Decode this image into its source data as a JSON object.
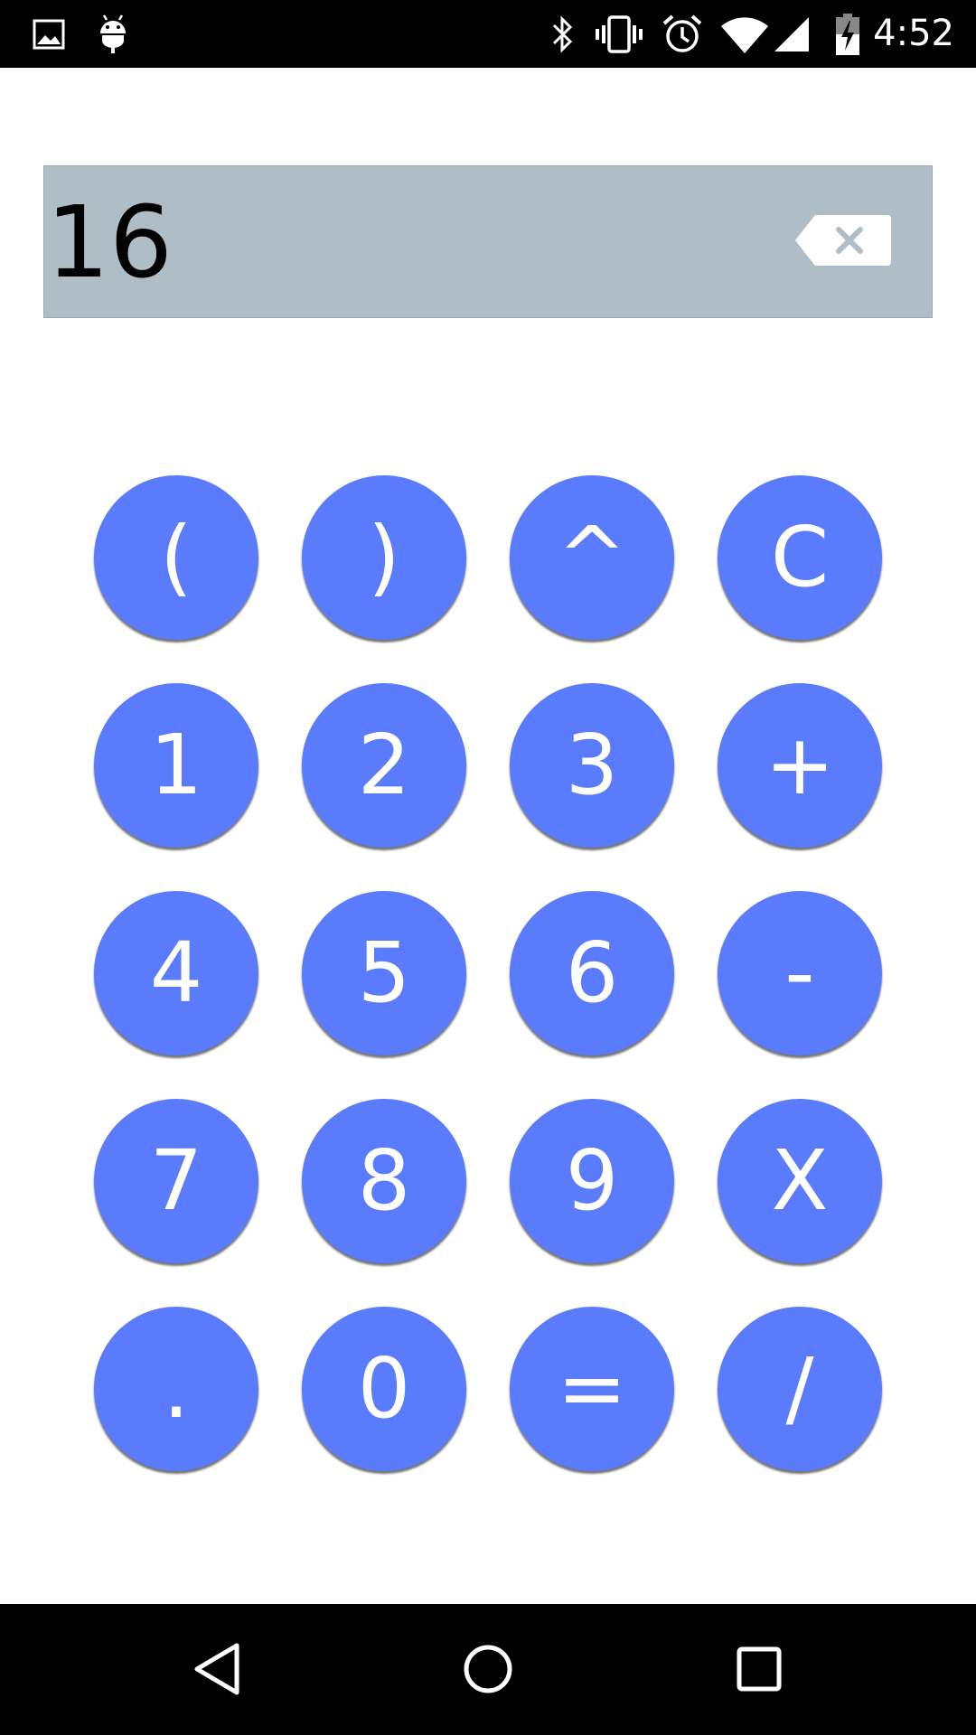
{
  "status_bar": {
    "time": "4:52",
    "icons": [
      "gallery-icon",
      "android-debug-icon",
      "bluetooth-icon",
      "vibrate-icon",
      "alarm-icon",
      "wifi-icon",
      "cell-signal-icon",
      "battery-charging-icon"
    ]
  },
  "display": {
    "value": "16",
    "backspace_icon": "backspace-icon"
  },
  "keypad": {
    "rows": [
      [
        "(",
        ")",
        "^",
        "C"
      ],
      [
        "1",
        "2",
        "3",
        "+"
      ],
      [
        "4",
        "5",
        "6",
        "-"
      ],
      [
        "7",
        "8",
        "9",
        "X"
      ],
      [
        ".",
        "0",
        "=",
        "/"
      ]
    ]
  },
  "nav_bar": {
    "icons": [
      "back-icon",
      "home-icon",
      "recents-icon"
    ]
  },
  "colors": {
    "key_background": "#5a7bfb",
    "display_background": "#afbec6",
    "bars": "#000000"
  }
}
